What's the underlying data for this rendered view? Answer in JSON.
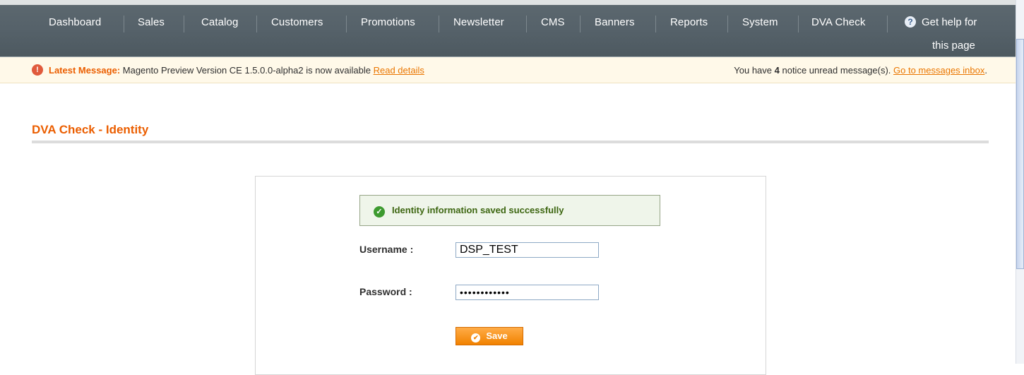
{
  "nav": {
    "items": [
      "Dashboard",
      "Sales",
      "Catalog",
      "Customers",
      "Promotions",
      "Newsletter",
      "CMS",
      "Banners",
      "Reports",
      "System",
      "DVA Check"
    ],
    "help_line1": "Get help for",
    "help_line2": "this page",
    "help_icon": "?"
  },
  "notice": {
    "icon": "!",
    "latest_label": "Latest Message:",
    "latest_text": " Magento Preview Version CE 1.5.0.0-alpha2 is now available ",
    "read_details": "Read details",
    "unread_prefix": "You have ",
    "unread_count": "4",
    "unread_suffix": " notice unread message(s). ",
    "inbox_link": "Go to messages inbox",
    "inbox_end": "."
  },
  "page": {
    "title": "DVA Check - Identity"
  },
  "form": {
    "success_message": "Identity information saved successfully",
    "username_label": "Username :",
    "username_value": "DSP_TEST",
    "password_label": "Password :",
    "password_value": "••••••••••••",
    "save_label": "Save"
  },
  "colors": {
    "accent": "#eb5e00",
    "nav_bg": "#56626a",
    "notice_bg": "#fff9e9",
    "success_bg": "#eff5ea",
    "button": "#f18200"
  }
}
